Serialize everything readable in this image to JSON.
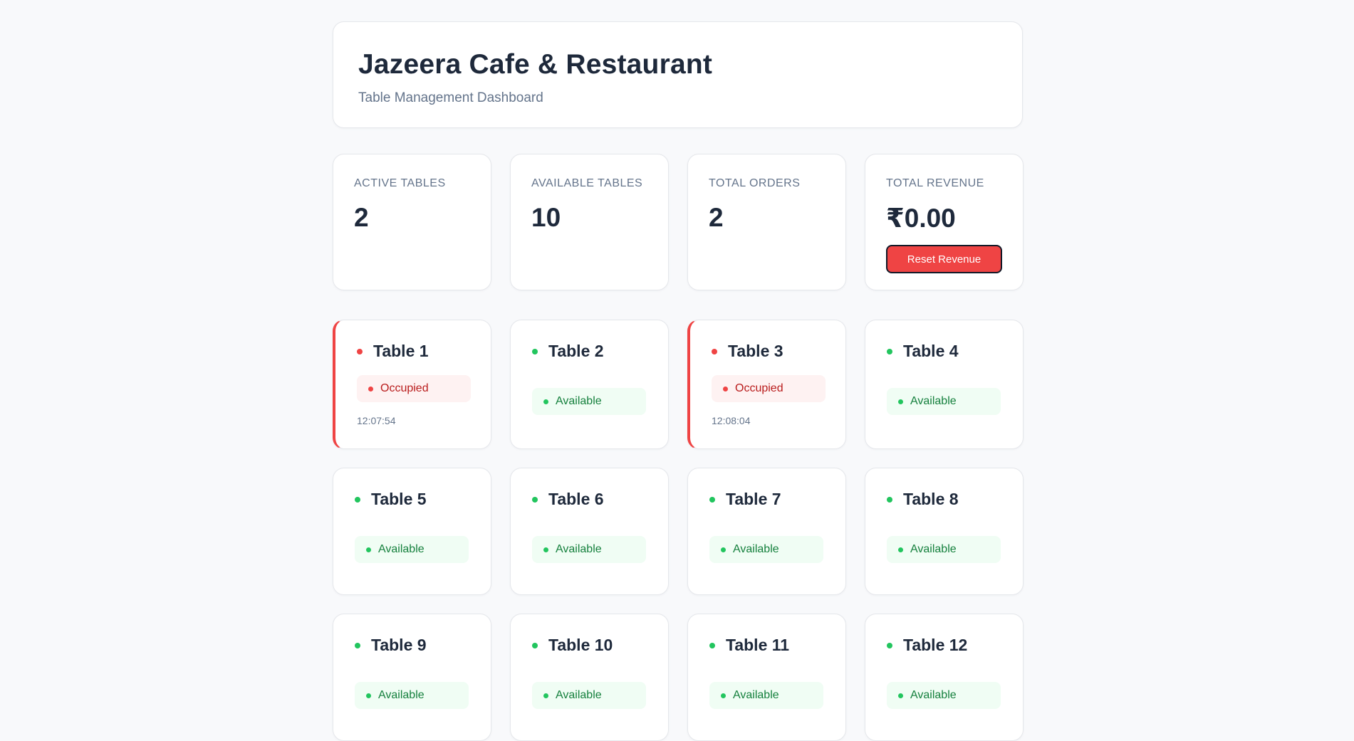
{
  "header": {
    "title": "Jazeera Cafe & Restaurant",
    "subtitle": "Table Management Dashboard"
  },
  "stats": [
    {
      "label": "ACTIVE TABLES",
      "value": "2"
    },
    {
      "label": "AVAILABLE TABLES",
      "value": "10"
    },
    {
      "label": "TOTAL ORDERS",
      "value": "2"
    },
    {
      "label": "TOTAL REVENUE",
      "value": "₹0.00"
    }
  ],
  "reset_button_label": "Reset Revenue",
  "tables": [
    {
      "name": "Table 1",
      "status": "Occupied",
      "time": "12:07:54"
    },
    {
      "name": "Table 2",
      "status": "Available",
      "time": ""
    },
    {
      "name": "Table 3",
      "status": "Occupied",
      "time": "12:08:04"
    },
    {
      "name": "Table 4",
      "status": "Available",
      "time": ""
    },
    {
      "name": "Table 5",
      "status": "Available",
      "time": ""
    },
    {
      "name": "Table 6",
      "status": "Available",
      "time": ""
    },
    {
      "name": "Table 7",
      "status": "Available",
      "time": ""
    },
    {
      "name": "Table 8",
      "status": "Available",
      "time": ""
    },
    {
      "name": "Table 9",
      "status": "Available",
      "time": ""
    },
    {
      "name": "Table 10",
      "status": "Available",
      "time": ""
    },
    {
      "name": "Table 11",
      "status": "Available",
      "time": ""
    },
    {
      "name": "Table 12",
      "status": "Available",
      "time": ""
    }
  ],
  "colors": {
    "occupied": "#ef4444",
    "available": "#22c55e",
    "accent_button": "#ef4444"
  }
}
